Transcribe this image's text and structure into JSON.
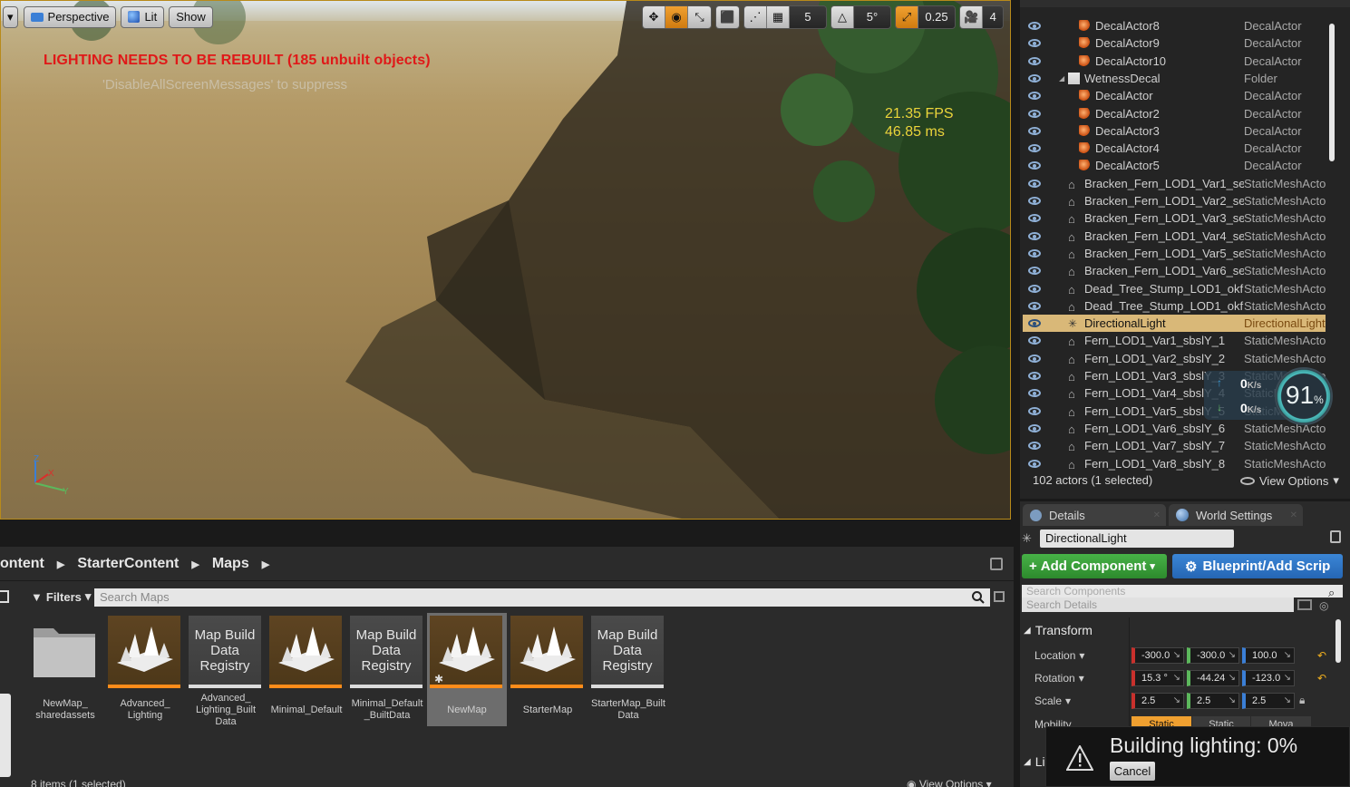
{
  "viewport": {
    "toolbar": {
      "perspective_label": "Perspective",
      "lit_label": "Lit",
      "show_label": "Show",
      "grid_snap_value": "5",
      "rotation_snap_value": "5°",
      "scale_snap_value": "0.25",
      "camera_speed_value": "4"
    },
    "lighting_warning": "LIGHTING NEEDS TO BE REBUILT (185 unbuilt objects)",
    "suppress_hint": "'DisableAllScreenMessages' to suppress",
    "fps": "21.35 FPS",
    "frame_ms": "46.85 ms",
    "accent_color": "#f39a1f"
  },
  "outliner": {
    "rows": [
      {
        "name": "DecalActor8",
        "type": "DecalActor",
        "indent": 2,
        "icon": "decal-icon",
        "selected": false
      },
      {
        "name": "DecalActor9",
        "type": "DecalActor",
        "indent": 2,
        "icon": "decal-icon",
        "selected": false
      },
      {
        "name": "DecalActor10",
        "type": "DecalActor",
        "indent": 2,
        "icon": "decal-icon",
        "selected": false
      },
      {
        "name": "WetnessDecal",
        "type": "Folder",
        "indent": 1,
        "icon": "folder-icon",
        "selected": false
      },
      {
        "name": "DecalActor",
        "type": "DecalActor",
        "indent": 2,
        "icon": "decal-icon",
        "selected": false
      },
      {
        "name": "DecalActor2",
        "type": "DecalActor",
        "indent": 2,
        "icon": "decal-icon",
        "selected": false
      },
      {
        "name": "DecalActor3",
        "type": "DecalActor",
        "indent": 2,
        "icon": "decal-icon",
        "selected": false
      },
      {
        "name": "DecalActor4",
        "type": "DecalActor",
        "indent": 2,
        "icon": "decal-icon",
        "selected": false
      },
      {
        "name": "DecalActor5",
        "type": "DecalActor",
        "indent": 2,
        "icon": "decal-icon",
        "selected": false
      },
      {
        "name": "Bracken_Fern_LOD1_Var1_se",
        "type": "StaticMeshActo",
        "indent": 1,
        "icon": "mesh-icon",
        "selected": false
      },
      {
        "name": "Bracken_Fern_LOD1_Var2_se",
        "type": "StaticMeshActo",
        "indent": 1,
        "icon": "mesh-icon",
        "selected": false
      },
      {
        "name": "Bracken_Fern_LOD1_Var3_se",
        "type": "StaticMeshActo",
        "indent": 1,
        "icon": "mesh-icon",
        "selected": false
      },
      {
        "name": "Bracken_Fern_LOD1_Var4_se",
        "type": "StaticMeshActo",
        "indent": 1,
        "icon": "mesh-icon",
        "selected": false
      },
      {
        "name": "Bracken_Fern_LOD1_Var5_se",
        "type": "StaticMeshActo",
        "indent": 1,
        "icon": "mesh-icon",
        "selected": false
      },
      {
        "name": "Bracken_Fern_LOD1_Var6_se",
        "type": "StaticMeshActo",
        "indent": 1,
        "icon": "mesh-icon",
        "selected": false
      },
      {
        "name": "Dead_Tree_Stump_LOD1_okf",
        "type": "StaticMeshActo",
        "indent": 1,
        "icon": "mesh-icon",
        "selected": false
      },
      {
        "name": "Dead_Tree_Stump_LOD1_okf",
        "type": "StaticMeshActo",
        "indent": 1,
        "icon": "mesh-icon",
        "selected": false
      },
      {
        "name": "DirectionalLight",
        "type": "DirectionalLight",
        "indent": 1,
        "icon": "light-icon",
        "selected": true
      },
      {
        "name": "Fern_LOD1_Var1_sbslY_1",
        "type": "StaticMeshActo",
        "indent": 1,
        "icon": "mesh-icon",
        "selected": false
      },
      {
        "name": "Fern_LOD1_Var2_sbslY_2",
        "type": "StaticMeshActo",
        "indent": 1,
        "icon": "mesh-icon",
        "selected": false
      },
      {
        "name": "Fern_LOD1_Var3_sbslY_3",
        "type": "StaticMeshActo",
        "indent": 1,
        "icon": "mesh-icon",
        "selected": false
      },
      {
        "name": "Fern_LOD1_Var4_sbslY_4",
        "type": "StaticMeshActo",
        "indent": 1,
        "icon": "mesh-icon",
        "selected": false
      },
      {
        "name": "Fern_LOD1_Var5_sbslY_5",
        "type": "StaticMeshActo",
        "indent": 1,
        "icon": "mesh-icon",
        "selected": false
      },
      {
        "name": "Fern_LOD1_Var6_sbslY_6",
        "type": "StaticMeshActo",
        "indent": 1,
        "icon": "mesh-icon",
        "selected": false
      },
      {
        "name": "Fern_LOD1_Var7_sbslY_7",
        "type": "StaticMeshActo",
        "indent": 1,
        "icon": "mesh-icon",
        "selected": false
      },
      {
        "name": "Fern_LOD1_Var8_sbslY_8",
        "type": "StaticMeshActo",
        "indent": 1,
        "icon": "mesh-icon",
        "selected": false
      }
    ],
    "footer": "102 actors (1 selected)",
    "view_options": "View Options",
    "selected_color": "#d9b878"
  },
  "net_widget": {
    "upload": "0",
    "download": "0",
    "unit": "K/s",
    "percent": "91",
    "percent_sign": "%"
  },
  "details": {
    "tab_details": "Details",
    "tab_world": "World Settings",
    "actor_name": "DirectionalLight",
    "add_component": "Add Component",
    "blueprint": "Blueprint/Add Scrip",
    "search_components": "Search Components",
    "search_details": "Search Details",
    "transform_label": "Transform",
    "location_label": "Location",
    "rotation_label": "Rotation",
    "scale_label": "Scale",
    "mobility_label": "Mobility",
    "location": [
      "-300.0",
      "-300.0",
      "100.0"
    ],
    "rotation": [
      "15.3 °",
      "-44.24",
      "-123.0"
    ],
    "scale": [
      "2.5",
      "2.5",
      "2.5"
    ],
    "mobility_options": [
      "Static",
      "Static",
      "Mova"
    ],
    "lights_section": "Li"
  },
  "toast": {
    "message": "Building lighting:  0%",
    "cancel": "Cancel"
  },
  "content_browser": {
    "breadcrumbs": [
      "ontent",
      "StarterContent",
      "Maps"
    ],
    "filters_label": "Filters",
    "search_placeholder": "Search Maps",
    "assets": [
      {
        "label": "NewMap_\nsharedassets",
        "kind": "folder",
        "thumb_text": "",
        "selected": false
      },
      {
        "label": "Advanced_\nLighting",
        "kind": "map",
        "thumb_text": "",
        "selected": false
      },
      {
        "label": "Advanced_\nLighting_Built\nData",
        "kind": "registry",
        "thumb_text": "Map Build\nData\nRegistry",
        "selected": false
      },
      {
        "label": "Minimal_Default",
        "kind": "map",
        "thumb_text": "",
        "selected": false
      },
      {
        "label": "Minimal_Default\n_BuiltData",
        "kind": "registry",
        "thumb_text": "Map Build\nData\nRegistry",
        "selected": false
      },
      {
        "label": "NewMap",
        "kind": "map",
        "thumb_text": "",
        "selected": true
      },
      {
        "label": "StarterMap",
        "kind": "map",
        "thumb_text": "",
        "selected": false
      },
      {
        "label": "StarterMap_Built\nData",
        "kind": "registry",
        "thumb_text": "Map Build\nData\nRegistry",
        "selected": false
      }
    ],
    "footer": "8 items (1 selected)",
    "view_options": "View Options"
  }
}
